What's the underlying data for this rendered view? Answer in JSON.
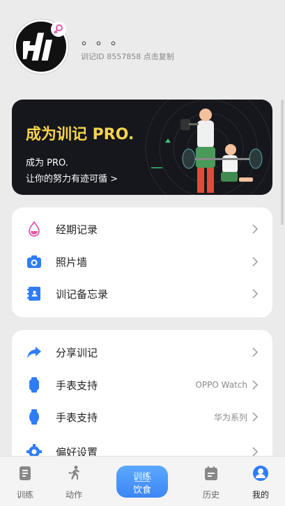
{
  "profile": {
    "nickname": "。。。",
    "user_id_text": "训记ID 8557858 点击复制",
    "gender_icon": "female-symbol-icon"
  },
  "banner": {
    "title": "成为训记 PRO.",
    "subtitle_1": "成为 PRO.",
    "subtitle_2": "让你的努力有迹可循 >"
  },
  "menu_group_1": [
    {
      "label": "经期记录",
      "icon": "droplet-icon",
      "value": ""
    },
    {
      "label": "照片墙",
      "icon": "camera-icon",
      "value": ""
    },
    {
      "label": "训记备忘录",
      "icon": "notebook-icon",
      "value": ""
    }
  ],
  "menu_group_2": [
    {
      "label": "分享训记",
      "icon": "share-arrow-icon",
      "value": ""
    },
    {
      "label": "手表支持",
      "icon": "watch-icon",
      "value": "OPPO Watch"
    },
    {
      "label": "手表支持",
      "icon": "watch-icon",
      "value": "华为系列"
    },
    {
      "label": "偏好设置",
      "icon": "gear-icon",
      "value": ""
    }
  ],
  "bottom_nav": {
    "items": [
      {
        "label": "训练",
        "icon": "clipboard-icon"
      },
      {
        "label": "动作",
        "icon": "running-person-icon"
      },
      {
        "label": "历史",
        "icon": "calendar-icon"
      },
      {
        "label": "我的",
        "icon": "person-icon"
      }
    ],
    "center_top": "训练",
    "center_bottom": "饮食"
  },
  "colors": {
    "accent": "#3d86f5",
    "pro_yellow": "#f7d44b",
    "banner_bg": "#16171c",
    "pink": "#e05aa6"
  }
}
